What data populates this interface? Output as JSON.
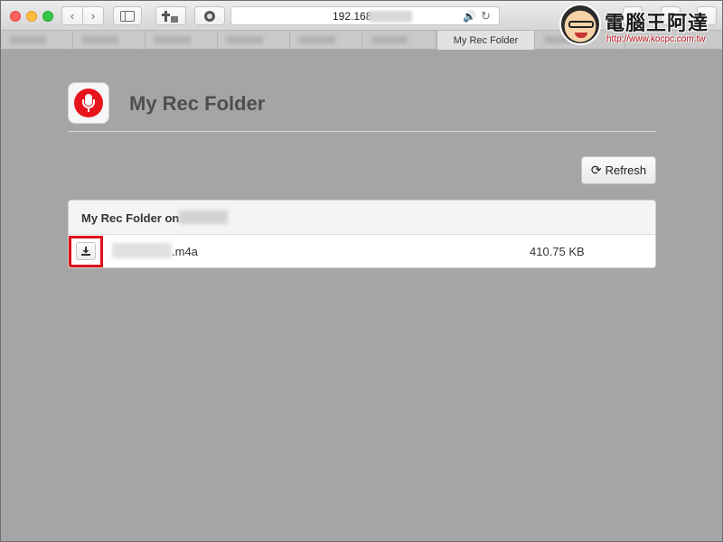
{
  "browser": {
    "address": "192.168",
    "active_tab": "My Rec Folder",
    "back_glyph": "‹",
    "forward_glyph": "›",
    "reload_glyph": "↻",
    "audio_glyph": "🔊"
  },
  "watermark": {
    "title": "電腦王阿達",
    "url": "http://www.kocpc.com.tw"
  },
  "page": {
    "title": "My Rec Folder",
    "refresh_label": "Refresh",
    "refresh_icon": "refresh-icon"
  },
  "panel": {
    "title": "My Rec Folder on",
    "files": [
      {
        "name_suffix": ".m4a",
        "size": "410.75 KB",
        "action_icon": "download-icon"
      }
    ]
  },
  "colors": {
    "accent_red": "#e8141c",
    "background": "#a5a5a5"
  }
}
